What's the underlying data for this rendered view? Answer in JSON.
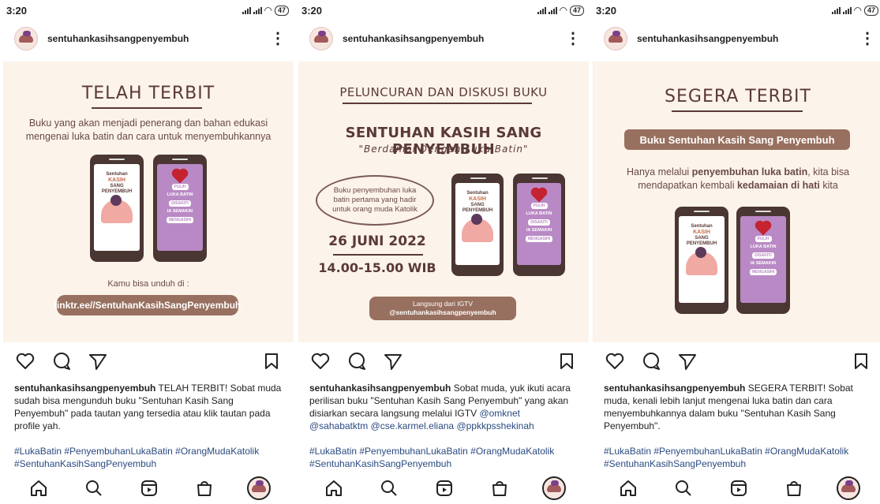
{
  "status": {
    "time": "3:20",
    "battery": "47"
  },
  "profile": {
    "username": "sentuhankasihsangpenyembuh"
  },
  "posts": [
    {
      "title": "TELAH TERBIT",
      "text": "Buku yang akan menjadi penerang dan bahan edukasi mengenai luka batin dan cara untuk menyembuhkannya",
      "download_label": "Kamu bisa unduh di :",
      "link": "linktr.ee//SentuhanKasihSangPenyembuh",
      "caption_user": "sentuhankasihsangpenyembuh",
      "caption_text": " TELAH TERBIT! Sobat muda sudah bisa mengunduh buku \"Sentuhan Kasih Sang Penyembuh\" pada tautan yang tersedia atau klik tautan pada profile yah.",
      "hashtags": "#LukaBatin #PenyembuhanLukaBatin #OrangMudaKatolik #SentuhanKasihSangPenyembuh"
    },
    {
      "title": "PELUNCURAN DAN DISKUSI BUKU",
      "book_title": "SENTUHAN KASIH SANG PENYEMBUH",
      "subtitle": "\"Berdamai Dengan Luka Batin\"",
      "oval_text": "Buku penyembuhan luka batin pertama yang hadir untuk orang muda Katolik",
      "date": "26 JUNI 2022",
      "time": "14.00-15.00 WIB",
      "live_label": "Langsung dari IGTV",
      "live_handle": "@sentuhankasihsangpenyembuh",
      "caption_user": "sentuhankasihsangpenyembuh",
      "caption_text": " Sobat muda, yuk ikuti acara perilisan buku \"Sentuhan Kasih Sang Penyembuh\" yang akan disiarkan secara langsung melalui IGTV ",
      "mentions": "@omknet @sahabatktm @cse.karmel.eliana @ppkkpsshekinah",
      "hashtags": "#LukaBatin #PenyembuhanLukaBatin #OrangMudaKatolik #SentuhanKasihSangPenyembuh"
    },
    {
      "title": "SEGERA TERBIT",
      "banner": "Buku Sentuhan Kasih Sang Penyembuh",
      "text_a": "Hanya melalui ",
      "text_b": "penyembuhan luka batin",
      "text_c": ", kita bisa mendapatkan kembali ",
      "text_d": "kedamaian di hati",
      "text_e": " kita",
      "caption_user": "sentuhankasihsangpenyembuh",
      "caption_text": " SEGERA TERBIT! Sobat muda, kenali lebih lanjut mengenai luka batin dan cara menyembuhkannya dalam buku \"Sentuhan Kasih Sang Penyembuh\".",
      "hashtags": "#LukaBatin #PenyembuhanLukaBatin #OrangMudaKatolik #SentuhanKasihSangPenyembuh"
    }
  ],
  "book_cover": {
    "line1": "Sentuhan",
    "line2": "KASIH",
    "line3": "SANG",
    "line4": "PENYEMBUH"
  },
  "book_back": {
    "line1": "PULIH",
    "line2": "LUKA BATIN",
    "line3": "DISAKITI",
    "line4": "IA SEMAKIN",
    "line5": "MENGASIHI"
  },
  "colors": {
    "post_bg": "#fcf3ea",
    "accent_brown": "#98705f",
    "dark_brown": "#5a3a36",
    "purple": "#b989c5"
  }
}
